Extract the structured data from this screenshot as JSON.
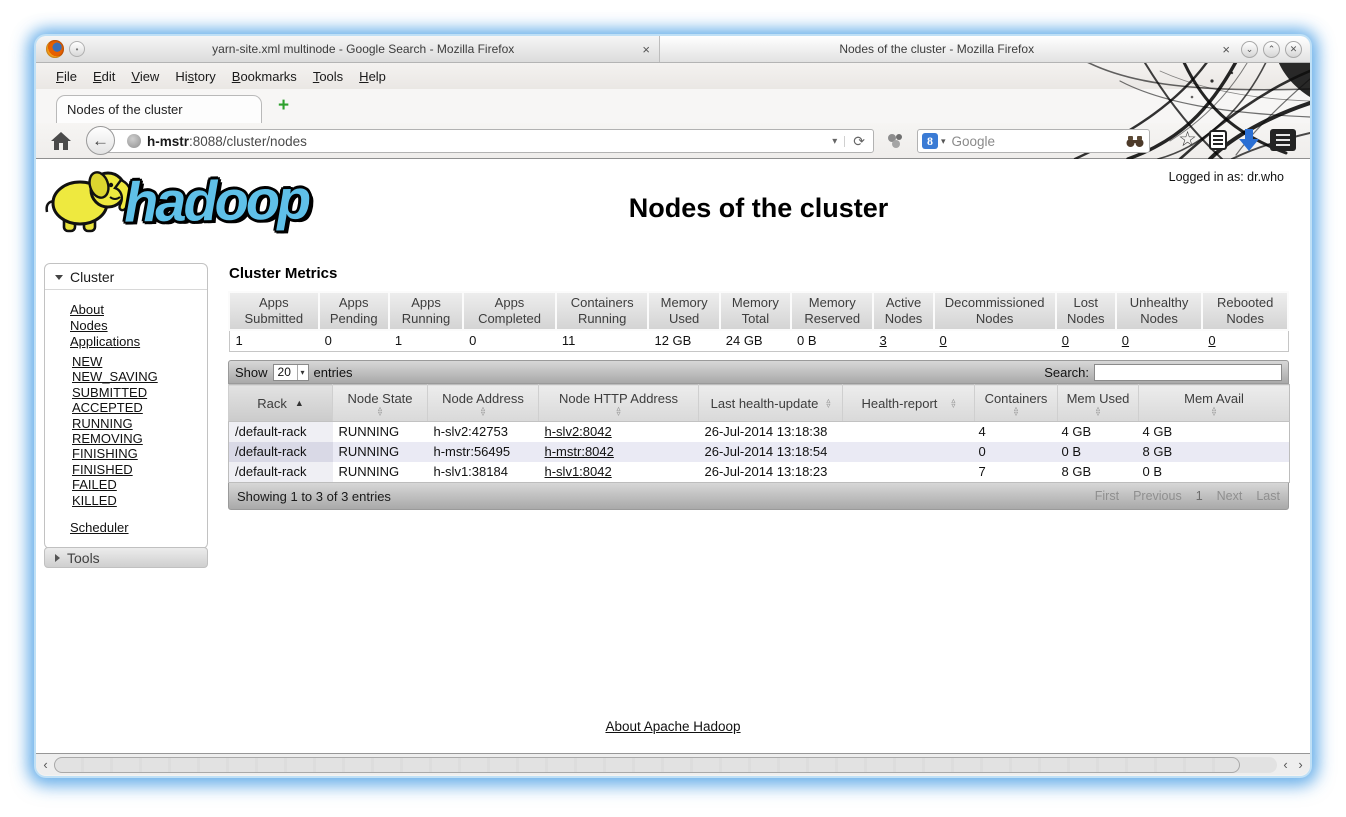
{
  "window": {
    "inactive_title": "yarn-site.xml multinode - Google Search - Mozilla Firefox",
    "active_title": "Nodes of the cluster - Mozilla Firefox",
    "close_glyph": "×",
    "minimize_glyph": "⌄",
    "maximize_glyph": "⌃",
    "controls_close_glyph": "✕"
  },
  "menubar": {
    "items": [
      {
        "pre": "",
        "accel": "F",
        "post": "ile"
      },
      {
        "pre": "",
        "accel": "E",
        "post": "dit"
      },
      {
        "pre": "",
        "accel": "V",
        "post": "iew"
      },
      {
        "pre": "Hi",
        "accel": "s",
        "post": "tory"
      },
      {
        "pre": "",
        "accel": "B",
        "post": "ookmarks"
      },
      {
        "pre": "",
        "accel": "T",
        "post": "ools"
      },
      {
        "pre": "",
        "accel": "H",
        "post": "elp"
      }
    ]
  },
  "tabs": {
    "active_label": "Nodes of the cluster",
    "new_tab_glyph": "+"
  },
  "navbar": {
    "back_glyph": "←",
    "url_host": "h-mstr",
    "url_rest": ":8088/cluster/nodes",
    "url_dropdown_glyph": "▾",
    "reload_glyph": "⟳",
    "search_placeholder": "Google",
    "search_dropdown_glyph": "▾",
    "google_badge_glyph": "8",
    "star_glyph": "☆"
  },
  "page": {
    "logged_in": "Logged in as: dr.who",
    "title": "Nodes of the cluster",
    "logo_text": "hadoop",
    "footer_link": "About Apache Hadoop"
  },
  "sidebar": {
    "cluster_header": "Cluster",
    "links": [
      "About",
      "Nodes",
      "Applications"
    ],
    "app_states": [
      "NEW",
      "NEW_SAVING",
      "SUBMITTED",
      "ACCEPTED",
      "RUNNING",
      "REMOVING",
      "FINISHING",
      "FINISHED",
      "FAILED",
      "KILLED"
    ],
    "scheduler": "Scheduler",
    "tools_header": "Tools"
  },
  "metrics": {
    "heading": "Cluster Metrics",
    "columns": [
      "Apps Submitted",
      "Apps Pending",
      "Apps Running",
      "Apps Completed",
      "Containers Running",
      "Memory Used",
      "Memory Total",
      "Memory Reserved",
      "Active Nodes",
      "Decommissioned Nodes",
      "Lost Nodes",
      "Unhealthy Nodes",
      "Rebooted Nodes"
    ],
    "values": [
      "1",
      "0",
      "1",
      "0",
      "11",
      "12 GB",
      "24 GB",
      "0 B",
      "3",
      "0",
      "0",
      "0",
      "0"
    ]
  },
  "table_controls": {
    "show_label": "Show",
    "page_size": "20",
    "entries_label": "entries",
    "search_label": "Search:",
    "search_value": ""
  },
  "nodes_table": {
    "columns": [
      "Rack",
      "Node State",
      "Node Address",
      "Node HTTP Address",
      "Last health-update",
      "Health-report",
      "Containers",
      "Mem Used",
      "Mem Avail"
    ],
    "rows": [
      {
        "rack": "/default-rack",
        "state": "RUNNING",
        "address": "h-slv2:42753",
        "http": "h-slv2:8042",
        "health_update": "26-Jul-2014 13:18:38",
        "health_report": "",
        "containers": "4",
        "mem_used": "4 GB",
        "mem_avail": "4 GB"
      },
      {
        "rack": "/default-rack",
        "state": "RUNNING",
        "address": "h-mstr:56495",
        "http": "h-mstr:8042",
        "health_update": "26-Jul-2014 13:18:54",
        "health_report": "",
        "containers": "0",
        "mem_used": "0 B",
        "mem_avail": "8 GB"
      },
      {
        "rack": "/default-rack",
        "state": "RUNNING",
        "address": "h-slv1:38184",
        "http": "h-slv1:8042",
        "health_update": "26-Jul-2014 13:18:23",
        "health_report": "",
        "containers": "7",
        "mem_used": "8 GB",
        "mem_avail": "0 B"
      }
    ],
    "footer": {
      "showing": "Showing 1 to 3 of 3 entries",
      "first": "First",
      "previous": "Previous",
      "page": "1",
      "next": "Next",
      "last": "Last"
    }
  },
  "colors": {
    "hadoop_blue": "#5fc0e8",
    "row_stripe": "#eaeaf4",
    "frame_glow": "#8fc7ee",
    "google_badge": "#3a7bd5",
    "new_tab_green": "#2ca02c",
    "download_arrow": "#2a6fd4"
  }
}
